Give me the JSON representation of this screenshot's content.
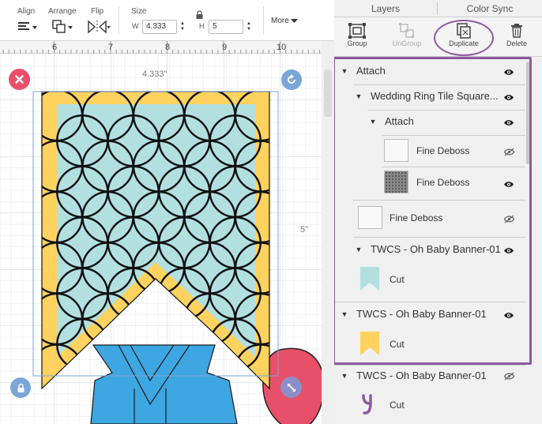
{
  "toolbar": {
    "align_label": "Align",
    "arrange_label": "Arrange",
    "flip_label": "Flip",
    "size_label": "Size",
    "width_letter": "W",
    "width_value": "4.333",
    "height_letter": "H",
    "height_value": "5",
    "more_label": "More"
  },
  "ruler": {
    "ticks": [
      "6",
      "7",
      "8",
      "9",
      "10"
    ]
  },
  "canvas": {
    "width_dim": "4.333\"",
    "height_dim": "5\""
  },
  "tabs": {
    "layers": "Layers",
    "color_sync": "Color Sync"
  },
  "actions": {
    "group": "Group",
    "ungroup": "UnGroup",
    "duplicate": "Duplicate",
    "delete": "Delete"
  },
  "layers": {
    "attach_1": "Attach",
    "wedding": "Wedding Ring Tile Square...",
    "attach_2": "Attach",
    "fine_deboss_1": "Fine Deboss",
    "fine_deboss_2": "Fine Deboss",
    "fine_deboss_3": "Fine Deboss",
    "twcs_1": "TWCS - Oh Baby Banner-01",
    "cut_1": "Cut",
    "twcs_2": "TWCS - Oh Baby Banner-01",
    "cut_2": "Cut",
    "twcs_3": "TWCS - Oh Baby Banner-01",
    "cut_3": "Cut"
  },
  "colors": {
    "accent": "#8c5aa0",
    "banner_yellow": "#fdd25f",
    "banner_teal": "#b2e0e1",
    "onesie_blue": "#3ea6e0",
    "balloon_pink": "#e8506a"
  }
}
